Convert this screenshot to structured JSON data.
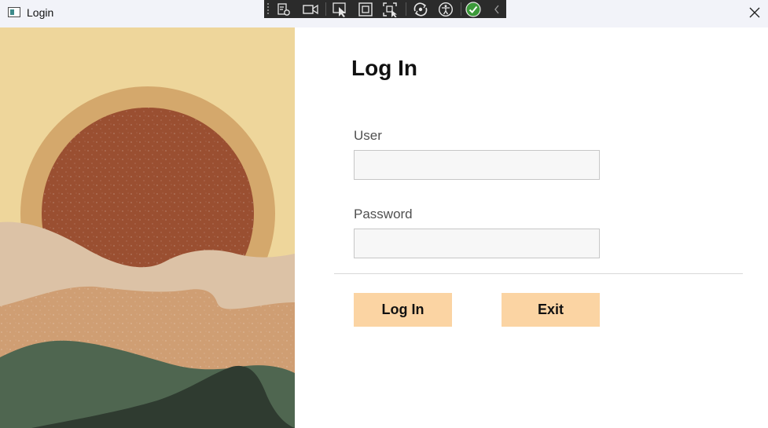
{
  "window": {
    "title": "Login"
  },
  "form": {
    "heading": "Log In",
    "user_label": "User",
    "user_value": "",
    "password_label": "Password",
    "password_value": "",
    "login_button": "Log In",
    "exit_button": "Exit"
  },
  "debug_toolbar": {
    "tools": [
      "grip-icon",
      "live-visual-tree-icon",
      "record-icon",
      "select-element-icon",
      "display-layout-adorners-icon",
      "track-focused-element-icon",
      "hot-reload-icon",
      "accessibility-icon",
      "binding-success-check-icon",
      "collapse-toolbar-icon"
    ]
  },
  "colors": {
    "button_bg": "#fbd4a3",
    "titlebar_bg": "#f2f3f9",
    "input_bg": "#f7f7f7",
    "sky": "#eed69b",
    "sun_ring": "#d4a86c",
    "sun": "#9a4f31",
    "dune_light": "#dcc2a6",
    "dune_mid": "#cf9e73",
    "hill_green": "#4f6650",
    "hill_dark": "#2f3b30"
  }
}
